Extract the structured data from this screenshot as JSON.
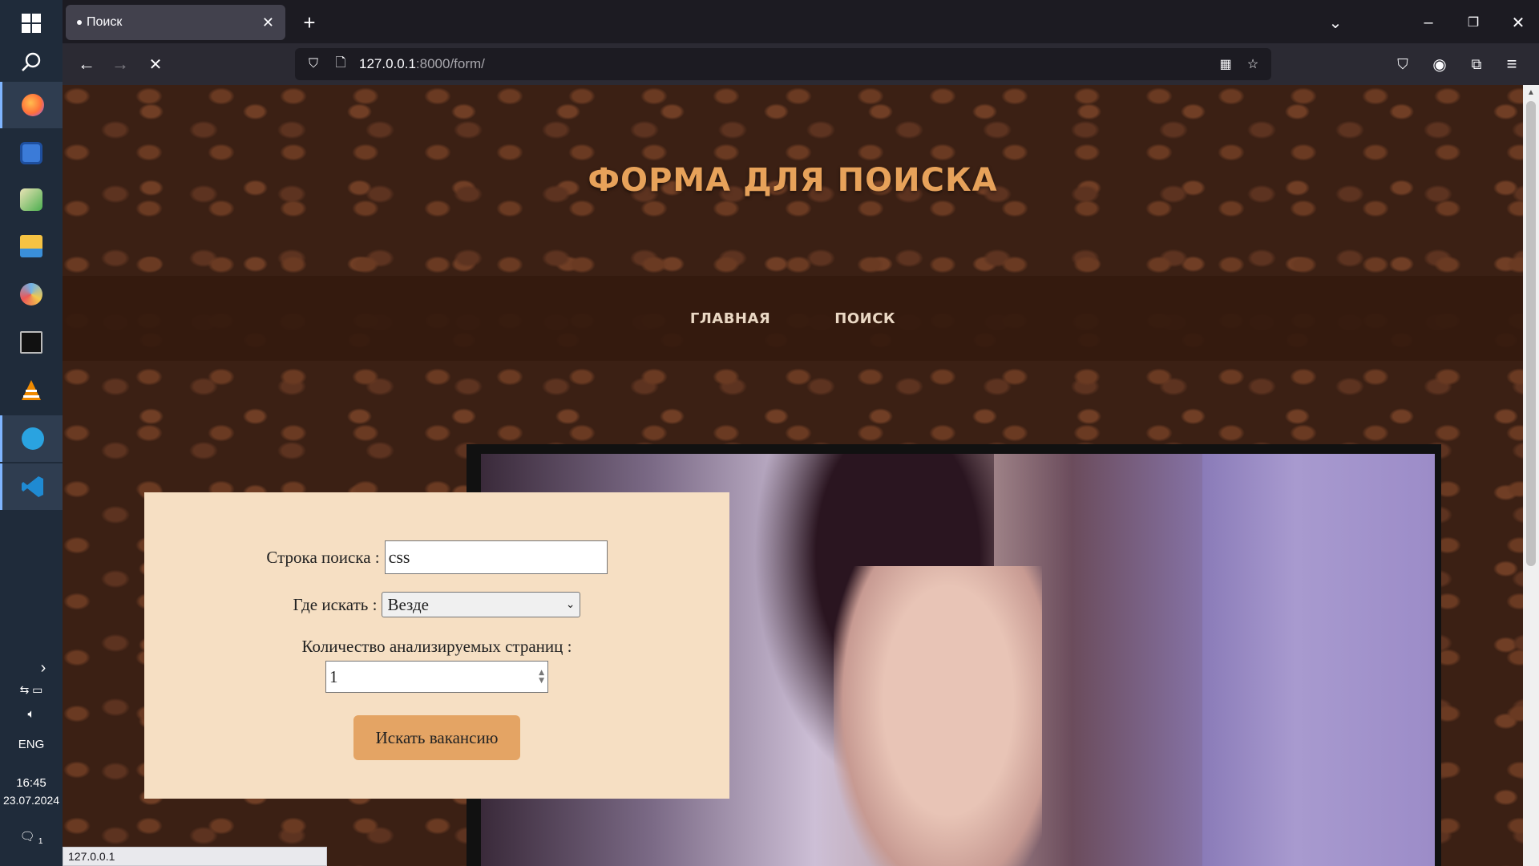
{
  "taskbar": {
    "apps": [
      {
        "icon": "start-icon"
      },
      {
        "icon": "search-icon"
      },
      {
        "icon": "firefox-icon",
        "color": "#ff7139"
      },
      {
        "icon": "save-disk-icon",
        "color": "#3b7bd8"
      },
      {
        "icon": "image-editor-icon",
        "color": "#4caf50"
      },
      {
        "icon": "file-explorer-icon",
        "color": "#f6c343"
      },
      {
        "icon": "paint-icon",
        "color": "#6fb3e8"
      },
      {
        "icon": "terminal-icon",
        "color": "#111111"
      },
      {
        "icon": "vlc-icon",
        "color": "#f08a00"
      },
      {
        "icon": "telegram-icon",
        "color": "#2aa3e0"
      },
      {
        "icon": "vscode-icon",
        "color": "#1f8ad2"
      }
    ],
    "language": "ENG",
    "time": "16:45",
    "date": "23.07.2024",
    "notification_count": "1"
  },
  "browser": {
    "tab_title": "Поиск",
    "url_host": "127.0.0.1",
    "url_path": ":8000/form/",
    "status_url": "127.0.0.1"
  },
  "page": {
    "title": "ФОРМА ДЛЯ ПОИСКА",
    "nav": [
      "ГЛАВНАЯ",
      "ПОИСК"
    ],
    "form": {
      "query_label": "Строка поиска :",
      "query_value": "css",
      "where_label": "Где искать :",
      "where_value": "Везде",
      "pages_label": "Количество анализируемых страниц :",
      "pages_value": "1",
      "submit_label": "Искать вакансию"
    }
  },
  "colors": {
    "accent_title": "#e7a25a",
    "form_bg": "#f6dfc3",
    "button_bg": "#e4a464"
  }
}
